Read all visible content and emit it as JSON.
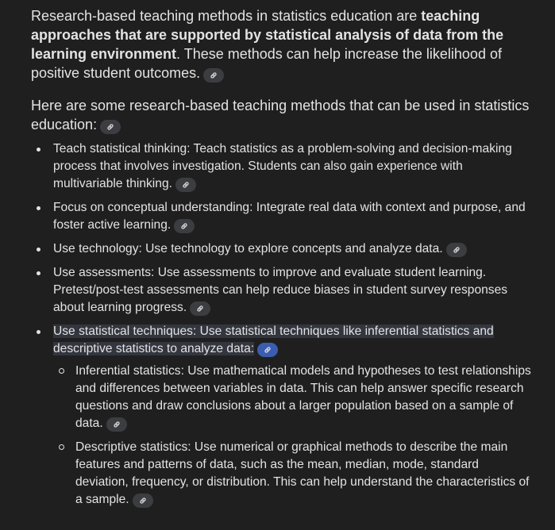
{
  "intro": {
    "pre": "Research-based teaching methods in statistics education are ",
    "bold": "teaching approaches that are supported by statistical analysis of data from the learning environment",
    "post": ". These methods can help increase the likelihood of positive student outcomes."
  },
  "list_intro": "Here are some research-based teaching methods that can be used in statistics education:",
  "items": [
    {
      "text": "Teach statistical thinking: Teach statistics as a problem-solving and decision-making process that involves investigation. Students can also gain experience with multivariable thinking."
    },
    {
      "text": "Focus on conceptual understanding: Integrate real data with context and purpose, and foster active learning."
    },
    {
      "text": "Use technology: Use technology to explore concepts and analyze data."
    },
    {
      "text": "Use assessments: Use assessments to improve and evaluate student learning. Pretest/post-test assessments can help reduce biases in student survey responses about learning progress."
    },
    {
      "text": "Use statistical techniques: Use statistical techniques like inferential statistics and descriptive statistics to analyze data:"
    }
  ],
  "subitems": [
    {
      "text": "Inferential statistics: Use mathematical models and hypotheses to test relationships and differences between variables in data. This can help answer specific research questions and draw conclusions about a larger population based on a sample of data."
    },
    {
      "text": "Descriptive statistics: Use numerical or graphical methods to describe the main features and patterns of data, such as the mean, median, mode, standard deviation, frequency, or distribution. This can help understand the characteristics of a sample."
    }
  ],
  "icons": {
    "source_link": "link-icon"
  },
  "colors": {
    "background": "#1f1f1f",
    "text": "#e3e3e3",
    "chip": "#3b3d40",
    "chip_active": "#3b5db0",
    "highlight": "#33363f"
  }
}
